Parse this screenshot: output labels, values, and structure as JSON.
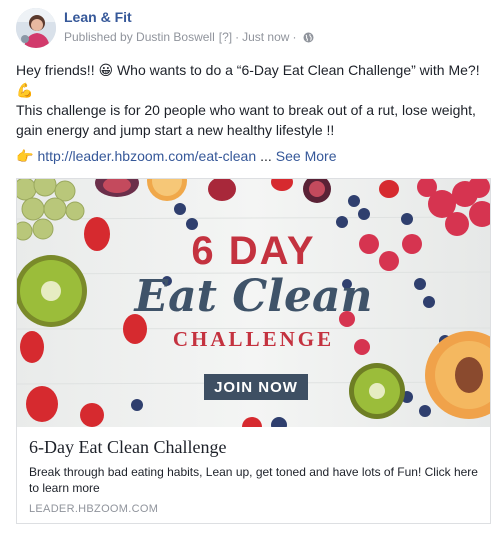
{
  "post": {
    "page_name": "Lean & Fit",
    "published_by": "Published by Dustin Boswell",
    "help_marker": "[?]",
    "separator": "·",
    "timestamp": "Just now",
    "audience_icon": "globe-icon"
  },
  "message": {
    "line1": "Hey friends!! 😀 Who wants to do a “6-Day Eat Clean Challenge” with Me?! 💪",
    "line2": "This challenge is for 20 people who want to break out of a rut, lose weight, gain energy and jump start a new healthy lifestyle !!",
    "pointer_icon": "👉",
    "link_text": "http://leader.hbzoom.com/eat-clean",
    "ellipsis": "...",
    "see_more": "See More"
  },
  "link_card": {
    "banner": {
      "line1": "6 DAY",
      "line2": "Eat Clean",
      "line3": "CHALLENGE",
      "button": "JOIN NOW"
    },
    "title": "6-Day Eat Clean Challenge",
    "description": "Break through bad eating habits, Lean up, get toned and have lots of Fun! Click here to learn more",
    "domain": "LEADER.HBZOOM.COM"
  },
  "colors": {
    "link": "#365899",
    "meta": "#90949c",
    "banner_red": "#c4323f",
    "banner_navy": "#3f5369"
  }
}
